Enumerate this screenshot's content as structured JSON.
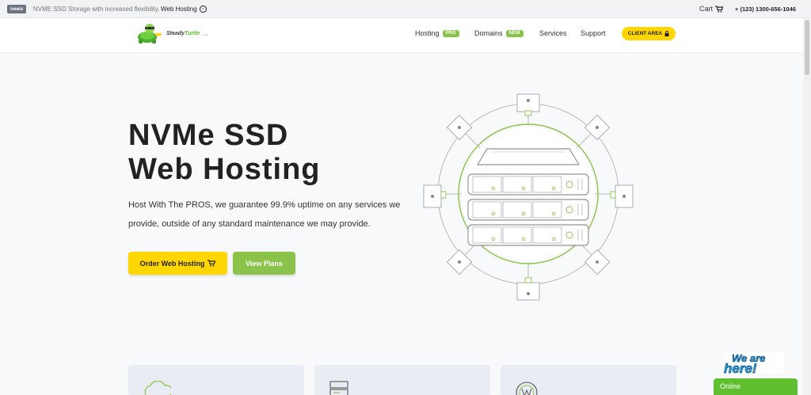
{
  "topbar": {
    "badge": "news",
    "text": "NVME SSD Storage with increased flexibility.",
    "link": "Web Hosting",
    "cart": "Cart",
    "phone": "+ (123) 1300-656-1046"
  },
  "header": {
    "logo_word1": "Steady",
    "logo_word2": "Turtle",
    "logo_suffix": ".com",
    "nav": [
      {
        "label": "Hosting",
        "badge": "PRO"
      },
      {
        "label": "Domains",
        "badge": "NEW"
      },
      {
        "label": "Services"
      },
      {
        "label": "Support"
      }
    ],
    "client_area": "CLIENT AREA"
  },
  "hero": {
    "title_line1": "NVMe SSD",
    "title_line2": "Web Hosting",
    "subtitle": "Host With The PROS, we guarantee 99.9% uptime on any services we provide, outside of any standard maintenance we may provide.",
    "order_button": "Order Web Hosting",
    "plans_button": "View Plans"
  },
  "chat": {
    "bubble_line1": "We are",
    "bubble_line2": "here!",
    "status": "Online"
  },
  "colors": {
    "accent_yellow": "#ffd600",
    "accent_green": "#8bc34a",
    "logo_green": "#5fbf2e"
  },
  "icons": {
    "cart": "cart-icon",
    "lock": "lock-icon",
    "arrow": "arrow-circle-icon"
  }
}
